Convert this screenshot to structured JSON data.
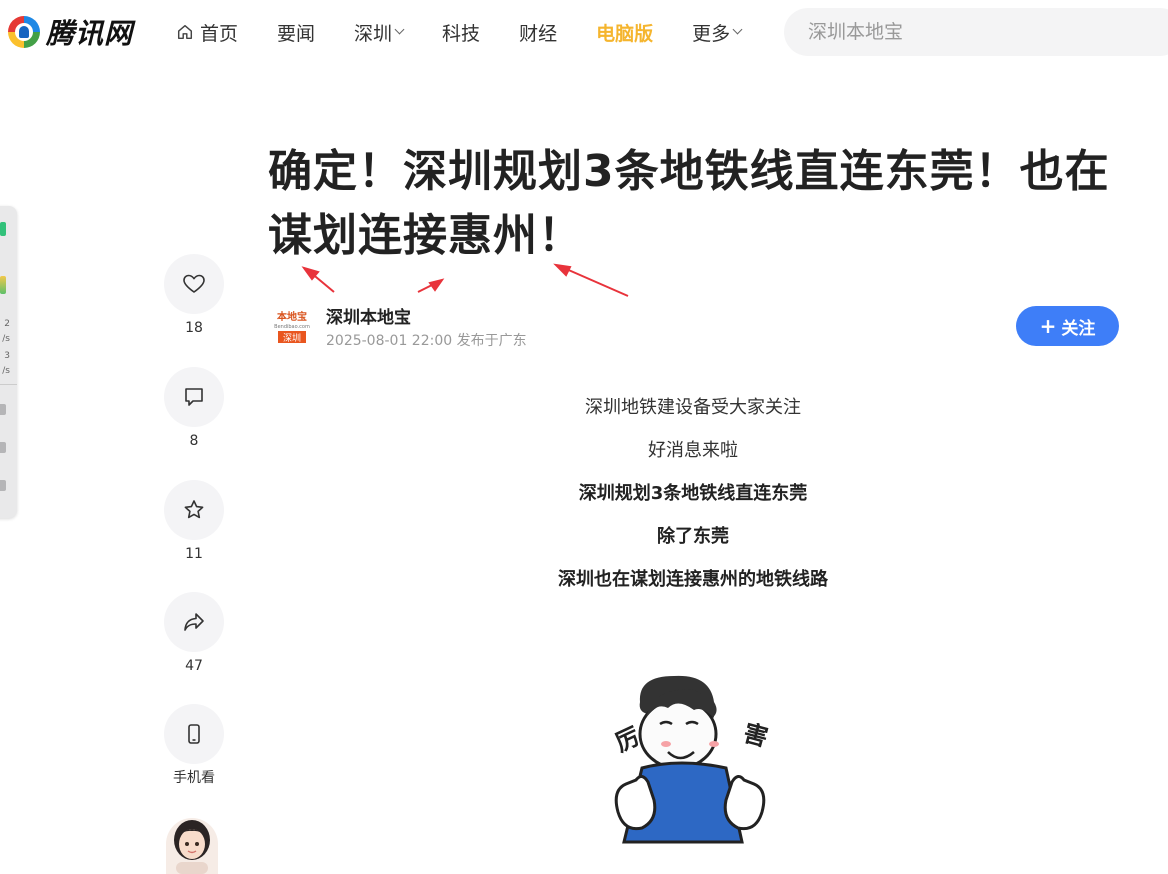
{
  "header": {
    "logo_text": "腾讯网",
    "nav": [
      {
        "label": "首页",
        "icon": "home-icon"
      },
      {
        "label": "要闻"
      },
      {
        "label": "深圳",
        "dropdown": true
      },
      {
        "label": "科技"
      },
      {
        "label": "财经"
      },
      {
        "label": "电脑版",
        "highlight": true
      },
      {
        "label": "更多",
        "dropdown": true
      }
    ],
    "search_placeholder": "深圳本地宝"
  },
  "side_tool": {
    "lines": [
      "2",
      "/s",
      "3",
      "/s"
    ]
  },
  "actions": {
    "like_count": "18",
    "comment_count": "8",
    "favorite_count": "11",
    "share_count": "47",
    "mobile_label": "手机看"
  },
  "article": {
    "title": "确定！深圳规划3条地铁线直连东莞！也在谋划连接惠州！",
    "author": {
      "name": "深圳本地宝",
      "logo_text_top": "本地宝",
      "logo_text_sub": "Bendibao.com",
      "logo_text_city": "深圳",
      "published": "2025-08-01 22:00 发布于广东"
    },
    "follow_label": "关注",
    "paragraphs": [
      {
        "text": "深圳地铁建设备受大家关注",
        "bold": false
      },
      {
        "text": "好消息来啦",
        "bold": false
      },
      {
        "text": "深圳规划3条地铁线直连东莞",
        "bold": true
      },
      {
        "text": "除了东莞",
        "bold": true
      },
      {
        "text": "深圳也在谋划连接惠州的地铁线路",
        "bold": true
      }
    ],
    "illustration_text": [
      "厉",
      "害"
    ]
  },
  "colors": {
    "accent": "#3e7ef8",
    "highlight_nav": "#f5b52e",
    "annotation_arrow": "#e8333b"
  }
}
